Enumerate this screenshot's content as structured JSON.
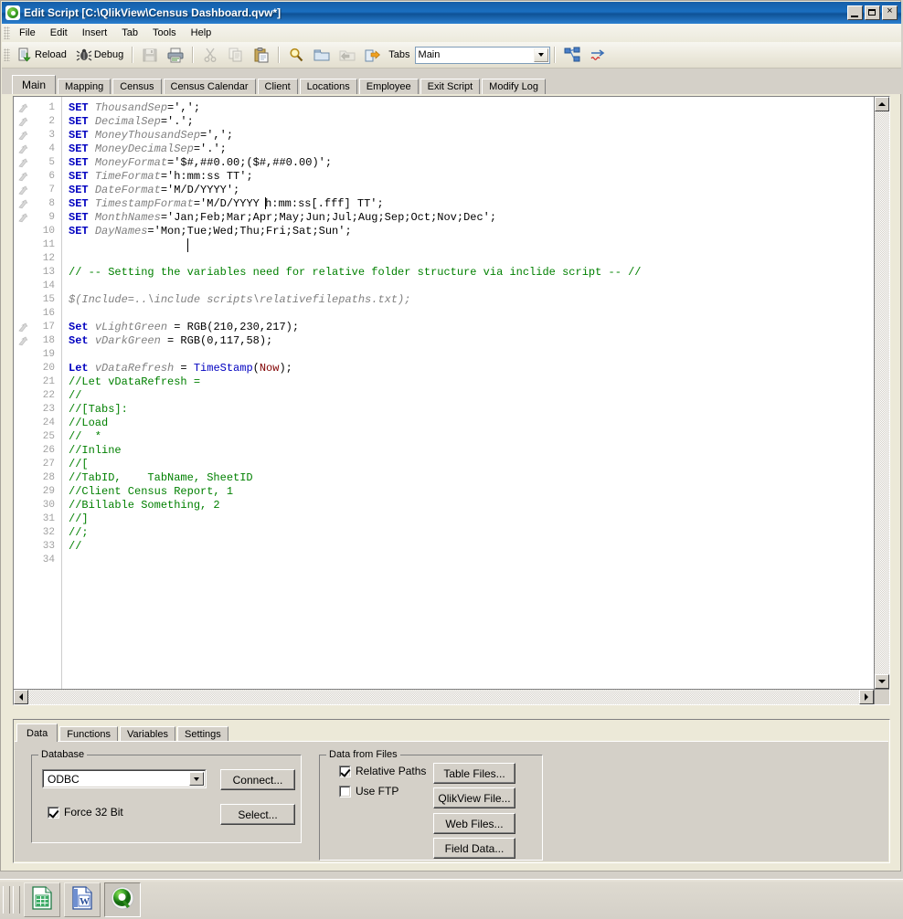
{
  "window": {
    "title": "Edit Script [C:\\QlikView\\Census Dashboard.qvw*]",
    "icon": "qlikview-logo-icon",
    "buttons": {
      "minimize": "_",
      "maximize": "□",
      "close": "×"
    }
  },
  "menu": {
    "items": [
      {
        "label": "File"
      },
      {
        "label": "Edit"
      },
      {
        "label": "Insert"
      },
      {
        "label": "Tab"
      },
      {
        "label": "Tools"
      },
      {
        "label": "Help"
      }
    ]
  },
  "toolbar": {
    "reload_label": "Reload",
    "debug_label": "Debug",
    "tabs_label": "Tabs",
    "tabs_value": "Main",
    "icons": {
      "reload": "reload-icon",
      "debug": "debug-bug-icon",
      "save": "save-disk-icon",
      "print": "print-icon",
      "cut": "cut-scissors-icon",
      "copy": "copy-icon",
      "paste": "paste-icon",
      "search": "search-magnifier-icon",
      "open": "open-folder-icon",
      "back": "back-arrow-icon",
      "forward": "forward-arrow-icon",
      "table_viewer": "table-viewer-icon",
      "squiggle": "squiggle-arrow-icon"
    }
  },
  "script_tabs": {
    "active": "Main",
    "items": [
      {
        "label": "Main",
        "active": true
      },
      {
        "label": "Mapping",
        "active": false
      },
      {
        "label": "Census",
        "active": false
      },
      {
        "label": "Census Calendar",
        "active": false
      },
      {
        "label": "Client",
        "active": false
      },
      {
        "label": "Locations",
        "active": false
      },
      {
        "label": "Employee",
        "active": false
      },
      {
        "label": "Exit Script",
        "active": false
      },
      {
        "label": "Modify Log",
        "active": false
      }
    ]
  },
  "editor": {
    "total_lines": 34,
    "bookmark_lines": [
      1,
      2,
      3,
      4,
      5,
      6,
      7,
      8,
      9,
      17,
      18
    ],
    "colors": {
      "keyword": "#0000c0",
      "variable": "#808080",
      "comment": "#008000",
      "literal": "#000000",
      "function": "#0000c0",
      "now": "#800000",
      "linenumber": "#a0a0a0"
    },
    "lines": [
      {
        "n": 1,
        "tokens": [
          {
            "t": "k",
            "x": "SET "
          },
          {
            "t": "v",
            "x": "ThousandSep"
          },
          {
            "t": "s",
            "x": "=',';"
          }
        ]
      },
      {
        "n": 2,
        "tokens": [
          {
            "t": "k",
            "x": "SET "
          },
          {
            "t": "v",
            "x": "DecimalSep"
          },
          {
            "t": "s",
            "x": "='.';"
          }
        ]
      },
      {
        "n": 3,
        "tokens": [
          {
            "t": "k",
            "x": "SET "
          },
          {
            "t": "v",
            "x": "MoneyThousandSep"
          },
          {
            "t": "s",
            "x": "=',';"
          }
        ]
      },
      {
        "n": 4,
        "tokens": [
          {
            "t": "k",
            "x": "SET "
          },
          {
            "t": "v",
            "x": "MoneyDecimalSep"
          },
          {
            "t": "s",
            "x": "='.';"
          }
        ]
      },
      {
        "n": 5,
        "tokens": [
          {
            "t": "k",
            "x": "SET "
          },
          {
            "t": "v",
            "x": "MoneyFormat"
          },
          {
            "t": "s",
            "x": "='$#,##0.00;($#,##0.00)';"
          }
        ]
      },
      {
        "n": 6,
        "tokens": [
          {
            "t": "k",
            "x": "SET "
          },
          {
            "t": "v",
            "x": "TimeFormat"
          },
          {
            "t": "s",
            "x": "='h:mm:ss TT';"
          }
        ]
      },
      {
        "n": 7,
        "tokens": [
          {
            "t": "k",
            "x": "SET "
          },
          {
            "t": "v",
            "x": "DateFormat"
          },
          {
            "t": "s",
            "x": "='M/D/YYYY';"
          }
        ]
      },
      {
        "n": 8,
        "tokens": [
          {
            "t": "k",
            "x": "SET "
          },
          {
            "t": "v",
            "x": "TimestampFormat"
          },
          {
            "t": "s",
            "x": "='M/D/YYYY "
          },
          {
            "t": "caret",
            "x": ""
          },
          {
            "t": "s",
            "x": "h:mm:ss[.fff] TT';"
          }
        ]
      },
      {
        "n": 9,
        "tokens": [
          {
            "t": "k",
            "x": "SET "
          },
          {
            "t": "v",
            "x": "MonthNames"
          },
          {
            "t": "s",
            "x": "='Jan;Feb;Mar;Apr;May;Jun;Jul;Aug;Sep;Oct;Nov;Dec';"
          }
        ]
      },
      {
        "n": 10,
        "tokens": [
          {
            "t": "k",
            "x": "SET "
          },
          {
            "t": "v",
            "x": "DayNames"
          },
          {
            "t": "s",
            "x": "='Mon;Tue;Wed;Thu;Fri;Sat;Sun';"
          }
        ]
      },
      {
        "n": 11,
        "tokens": []
      },
      {
        "n": 12,
        "tokens": []
      },
      {
        "n": 13,
        "tokens": [
          {
            "t": "c",
            "x": "// -- Setting the variables need for relative folder structure via inclide script -- //"
          }
        ]
      },
      {
        "n": 14,
        "tokens": []
      },
      {
        "n": 15,
        "tokens": [
          {
            "t": "inc",
            "x": "$(Include=..\\include scripts\\relativefilepaths.txt);"
          }
        ]
      },
      {
        "n": 16,
        "tokens": []
      },
      {
        "n": 17,
        "tokens": [
          {
            "t": "k",
            "x": "Set "
          },
          {
            "t": "v",
            "x": "vLightGreen"
          },
          {
            "t": "s",
            "x": " = RGB(210,230,217);"
          }
        ]
      },
      {
        "n": 18,
        "tokens": [
          {
            "t": "k",
            "x": "Set "
          },
          {
            "t": "v",
            "x": "vDarkGreen"
          },
          {
            "t": "s",
            "x": " = RGB(0,117,58);"
          }
        ]
      },
      {
        "n": 19,
        "tokens": []
      },
      {
        "n": 20,
        "tokens": [
          {
            "t": "k",
            "x": "Let "
          },
          {
            "t": "v",
            "x": "vDataRefresh"
          },
          {
            "t": "s",
            "x": " = "
          },
          {
            "t": "fn",
            "x": "TimeStamp"
          },
          {
            "t": "s",
            "x": "("
          },
          {
            "t": "nw",
            "x": "Now"
          },
          {
            "t": "s",
            "x": ");"
          }
        ]
      },
      {
        "n": 21,
        "tokens": [
          {
            "t": "c",
            "x": "//Let vDataRefresh ="
          }
        ]
      },
      {
        "n": 22,
        "tokens": [
          {
            "t": "c",
            "x": "//"
          }
        ]
      },
      {
        "n": 23,
        "tokens": [
          {
            "t": "c",
            "x": "//[Tabs]:"
          }
        ]
      },
      {
        "n": 24,
        "tokens": [
          {
            "t": "c",
            "x": "//Load"
          }
        ]
      },
      {
        "n": 25,
        "tokens": [
          {
            "t": "c",
            "x": "//  *"
          }
        ]
      },
      {
        "n": 26,
        "tokens": [
          {
            "t": "c",
            "x": "//Inline"
          }
        ]
      },
      {
        "n": 27,
        "tokens": [
          {
            "t": "c",
            "x": "//["
          }
        ]
      },
      {
        "n": 28,
        "tokens": [
          {
            "t": "c",
            "x": "//TabID,    TabName, SheetID"
          }
        ]
      },
      {
        "n": 29,
        "tokens": [
          {
            "t": "c",
            "x": "//Client Census Report, 1"
          }
        ]
      },
      {
        "n": 30,
        "tokens": [
          {
            "t": "c",
            "x": "//Billable Something, 2"
          }
        ]
      },
      {
        "n": 31,
        "tokens": [
          {
            "t": "c",
            "x": "//]"
          }
        ]
      },
      {
        "n": 32,
        "tokens": [
          {
            "t": "c",
            "x": "//;"
          }
        ]
      },
      {
        "n": 33,
        "tokens": [
          {
            "t": "c",
            "x": "//"
          }
        ]
      },
      {
        "n": 34,
        "tokens": []
      }
    ]
  },
  "bottom": {
    "tabs": [
      {
        "label": "Data",
        "active": true
      },
      {
        "label": "Functions",
        "active": false
      },
      {
        "label": "Variables",
        "active": false
      },
      {
        "label": "Settings",
        "active": false
      }
    ],
    "database": {
      "group_title": "Database",
      "selected": "ODBC",
      "connect_label": "Connect...",
      "select_label": "Select...",
      "force32_label": "Force 32 Bit",
      "force32_checked": true
    },
    "data_from_files": {
      "group_title": "Data from Files",
      "relative_paths_label": "Relative Paths",
      "relative_paths_checked": true,
      "use_ftp_label": "Use FTP",
      "use_ftp_checked": false,
      "buttons": [
        {
          "label": "Table Files..."
        },
        {
          "label": "QlikView File..."
        },
        {
          "label": "Web Files..."
        },
        {
          "label": "Field Data..."
        }
      ]
    }
  },
  "taskbar": {
    "items": [
      {
        "name": "excel",
        "pressed": false
      },
      {
        "name": "word",
        "pressed": false
      },
      {
        "name": "qlikview",
        "pressed": true
      }
    ]
  }
}
